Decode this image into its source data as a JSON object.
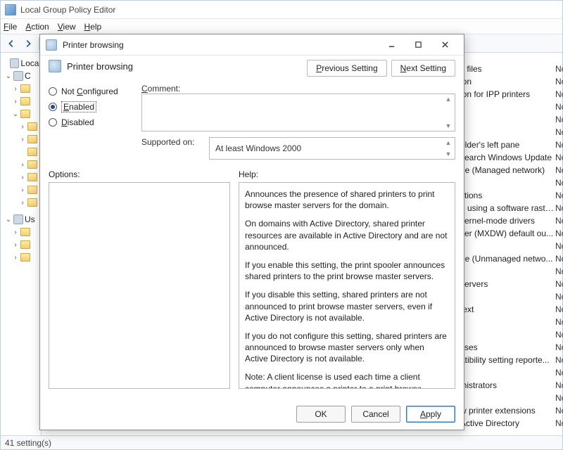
{
  "window": {
    "title": "Local Group Policy Editor",
    "status": "41 setting(s)"
  },
  "menubar": {
    "file": "File",
    "action": "Action",
    "view": "View",
    "help": "Help"
  },
  "tree": {
    "root": "Local",
    "n_comp_prefix": "C",
    "n_user_prefix": "Us"
  },
  "listpane": {
    "rows": [
      {
        "s": "c files",
        "st": "Not"
      },
      {
        "s": "ion",
        "st": "Not"
      },
      {
        "s": "ion for IPP printers",
        "st": "Not"
      },
      {
        "s": "",
        "st": "Not"
      },
      {
        "s": "",
        "st": "Not"
      },
      {
        "s": "",
        "st": "Not"
      },
      {
        "s": "older's left pane",
        "st": "Not"
      },
      {
        "s": "search Windows Update",
        "st": "Not"
      },
      {
        "s": "ge (Managed network)",
        "st": "Not"
      },
      {
        "s": "r",
        "st": "Not"
      },
      {
        "s": "ctions",
        "st": "Not"
      },
      {
        "s": "d using a software raste...",
        "st": "Not"
      },
      {
        "s": "kernel-mode drivers",
        "st": "Not"
      },
      {
        "s": "iter (MXDW) default ou...",
        "st": "Not"
      },
      {
        "s": "",
        "st": "Not"
      },
      {
        "s": "ge (Unmanaged netwo...",
        "st": "Not"
      },
      {
        "s": "",
        "st": "Not"
      },
      {
        "s": "servers",
        "st": "Not"
      },
      {
        "s": "",
        "st": "Not"
      },
      {
        "s": "text",
        "st": "Not"
      },
      {
        "s": "",
        "st": "Not"
      },
      {
        "s": "",
        "st": "Not"
      },
      {
        "s": "sses",
        "st": "Not"
      },
      {
        "s": "atibility setting reporte...",
        "st": "Not"
      },
      {
        "s": "",
        "st": "Not"
      },
      {
        "s": "inistrators",
        "st": "Not"
      },
      {
        "s": "",
        "st": "Not"
      },
      {
        "s": "w printer extensions",
        "st": "Not"
      },
      {
        "s": "Active Directory",
        "st": "Not"
      }
    ]
  },
  "dialog": {
    "title": "Printer browsing",
    "policy_name": "Printer browsing",
    "prev": "Previous Setting",
    "next": "Next Setting",
    "state_nc": "Not Configured",
    "state_en": "Enabled",
    "state_dis": "Disabled",
    "comment_label": "Comment:",
    "supported_label": "Supported on:",
    "supported_value": "At least Windows 2000",
    "options_label": "Options:",
    "help_label": "Help:",
    "help_p1": "Announces the presence of shared printers to print browse master servers for the domain.",
    "help_p2": "On domains with Active Directory, shared printer resources are available in Active Directory and are not announced.",
    "help_p3": "If you enable this setting, the print spooler announces shared printers to the print browse master servers.",
    "help_p4": "If you disable this setting, shared printers are not announced to print browse master servers, even if Active Directory is not available.",
    "help_p5": "If you do not configure this setting, shared printers are announced to browse master servers only when Active Directory is not available.",
    "help_p6": "Note: A client license is used each time a client computer announces a printer to a print browse master on the domain.",
    "ok": "OK",
    "cancel": "Cancel",
    "apply": "Apply"
  }
}
